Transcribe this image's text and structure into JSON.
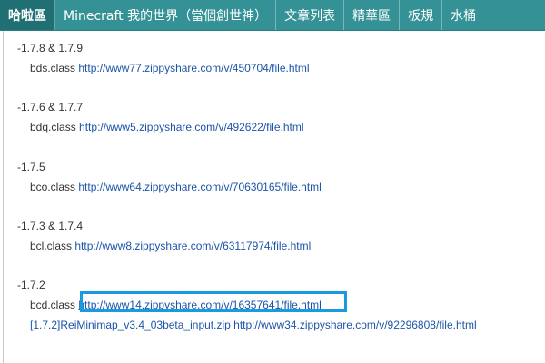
{
  "nav": {
    "items": [
      {
        "label": "哈啦區"
      },
      {
        "label": "Minecraft 我的世界（當個創世神）"
      },
      {
        "label": "文章列表"
      },
      {
        "label": "精華區"
      },
      {
        "label": "板規"
      },
      {
        "label": "水桶"
      }
    ]
  },
  "downloads": [
    {
      "version": "-1.7.8 & 1.7.9",
      "file": "bds.class",
      "url": "http://www77.zippyshare.com/v/450704/file.html"
    },
    {
      "version": "-1.7.6 & 1.7.7",
      "file": "bdq.class",
      "url": "http://www5.zippyshare.com/v/492622/file.html"
    },
    {
      "version": "-1.7.5",
      "file": "bco.class",
      "url": "http://www64.zippyshare.com/v/70630165/file.html"
    },
    {
      "version": "-1.7.3 & 1.7.4",
      "file": "bcl.class",
      "url": "http://www8.zippyshare.com/v/63117974/file.html"
    },
    {
      "version": "-1.7.2",
      "file": "bcd.class",
      "url": "http://www14.zippyshare.com/v/16357641/file.html",
      "extra_label": "[1.7.2]ReiMinimap_v3.4_03beta_input.zip",
      "extra_url": "http://www34.zippyshare.com/v/92296808/file.html"
    }
  ],
  "colors": {
    "nav_bg": "#349297",
    "nav_active_bg": "#1f6f73",
    "link": "#1d54a8",
    "highlight_border": "#1a9be0"
  }
}
